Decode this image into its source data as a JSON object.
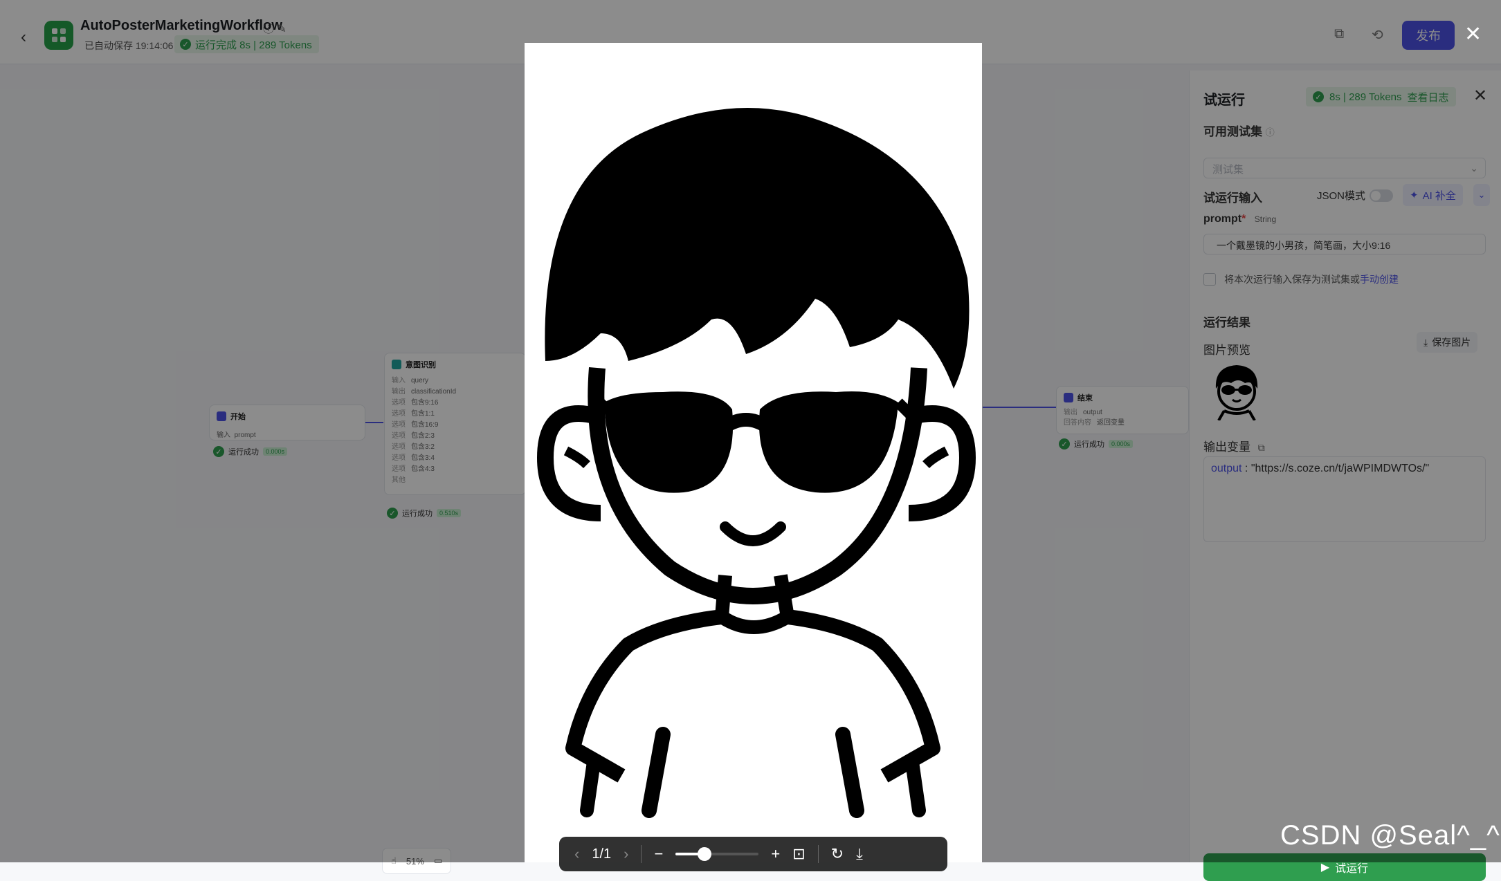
{
  "header": {
    "back_icon": "chevron-left-icon",
    "app_icon": "workflow-logo-icon",
    "workflow_name": "AutoPosterMarketingWorkflow",
    "autosave_text": "已自动保存 19:14:06",
    "run_status": "运行完成 8s | 289 Tokens",
    "publish_label": "发布"
  },
  "canvas": {
    "start_node": {
      "title": "开始",
      "row_label": "输入",
      "row_value": "prompt",
      "status": "运行成功",
      "duration": "0.000s"
    },
    "intent_node": {
      "title": "意图识别",
      "rows": [
        {
          "label": "输入",
          "value": "query"
        },
        {
          "label": "输出",
          "value": "classificationId"
        }
      ],
      "options": [
        {
          "label": "选项",
          "value": "包含9:16"
        },
        {
          "label": "选项",
          "value": "包含1:1"
        },
        {
          "label": "选项",
          "value": "包含16:9"
        },
        {
          "label": "选项",
          "value": "包含2:3"
        },
        {
          "label": "选项",
          "value": "包含3:2"
        },
        {
          "label": "选项",
          "value": "包含3:4"
        },
        {
          "label": "选项",
          "value": "包含4:3"
        },
        {
          "label": "其他",
          "value": ""
        }
      ],
      "status": "运行成功",
      "duration": "0.510s"
    },
    "end_node": {
      "title": "结束",
      "rows": [
        {
          "label": "输出",
          "value": "output"
        },
        {
          "label": "回答内容",
          "value": "返回变量"
        }
      ],
      "status": "运行成功",
      "duration": "0.000s"
    },
    "zoom": "51%"
  },
  "panel": {
    "title": "试运行",
    "badge": "8s | 289 Tokens",
    "view_log": "查看日志",
    "testset_label": "可用测试集",
    "testset_placeholder": "测试集",
    "input_label": "试运行输入",
    "json_mode": "JSON模式",
    "ai_fill": "AI 补全",
    "prompt_label": "prompt",
    "prompt_type": "String",
    "prompt_value": "一个戴墨镜的小男孩，简笔画，大小9:16",
    "save_as_testset": "将本次运行输入保存为测试集或",
    "manual_create": "手动创建",
    "result_label": "运行结果",
    "image_preview_label": "图片预览",
    "save_image": "保存图片",
    "output_var_label": "输出变量",
    "output_key": "output",
    "output_value": "\"https://s.coze.cn/t/jaWPIMDWTOs/\"",
    "run_button": "试运行"
  },
  "viewer": {
    "close_icon": "close-icon",
    "page_indicator": "1/1",
    "zoom_fraction": 0.35
  },
  "watermark": "CSDN @Seal^_^",
  "colors": {
    "accent": "#4d53e8",
    "success": "#2f9e4f",
    "overlay": "rgba(0,0,0,0.45)"
  }
}
